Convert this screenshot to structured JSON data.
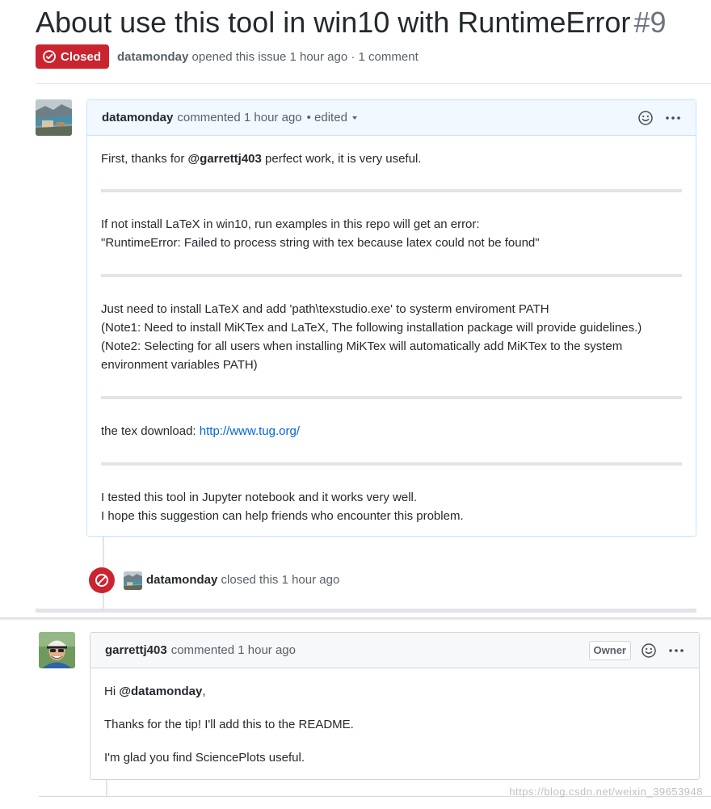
{
  "issue": {
    "title": "About use this tool in win10 with RuntimeError",
    "number": "#9",
    "state": "Closed",
    "author": "datamonday",
    "meta_action": "opened this issue 1 hour ago",
    "meta_comments": "· 1 comment"
  },
  "comment1": {
    "author": "datamonday",
    "action": "commented 1 hour ago",
    "edited": "• edited",
    "p1_before": "First, thanks for ",
    "p1_mention": "@garrettj403",
    "p1_after": " perfect work, it is very useful.",
    "p2_line1": "If not install LaTeX in win10, run examples in this repo will get an error:",
    "p2_line2": "\"RuntimeError: Failed to process string with tex because latex could not be found\"",
    "p3_line1": "Just need to install LaTeX and add 'path\\texstudio.exe' to systerm enviroment PATH",
    "p3_line2": "(Note1: Need to install MiKTex and LaTeX, The following installation package will provide guidelines.)",
    "p3_line3": "(Note2: Selecting for all users when installing MiKTex will automatically add MiKTex to the system environment variables PATH)",
    "p4_label": "the tex download: ",
    "p4_link": "http://www.tug.org/",
    "p5_line1": "I tested this tool in Jupyter notebook and it works very well.",
    "p5_line2": "I hope this suggestion can help friends who encounter this problem."
  },
  "close_event": {
    "author": "datamonday",
    "action": "closed this 1 hour ago"
  },
  "comment2": {
    "author": "garrettj403",
    "action": "commented 1 hour ago",
    "badge": "Owner",
    "p1_before": "Hi ",
    "p1_mention": "@datamonday",
    "p1_after": ",",
    "p2": "Thanks for the tip! I'll add this to the README.",
    "p3": "I'm glad you find SciencePlots useful."
  },
  "watermark": "https://blog.csdn.net/weixin_39653948",
  "colors": {
    "closed_red": "#cb2431",
    "link_blue": "#0366d6",
    "header_blue_bg": "#f1f8ff",
    "header_blue_border": "#c8e1ff"
  },
  "icons": {
    "state": "issue-closed-icon",
    "reaction": "smiley-icon",
    "more": "kebab-horizontal-icon",
    "close_event": "circle-slash-icon"
  }
}
